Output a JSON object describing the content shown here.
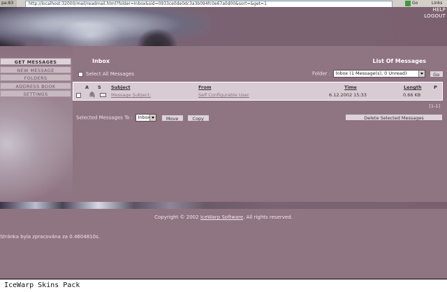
{
  "browser": {
    "tab_prefix": "pa:83",
    "url": "http://localhost:32000/mail/readmail.html?folder=Inbox&sid=0933ce0de0dc3a3b094fc0e67a0d00&sort=&get=1",
    "go_label": "Go",
    "links_label": "Links"
  },
  "header": {
    "help": "HELP",
    "logout": "LOGOUT"
  },
  "nav": {
    "items": [
      {
        "label": "GET MESSAGES"
      },
      {
        "label": "NEW MESSAGE"
      },
      {
        "label": "FOLDERS"
      },
      {
        "label": "ADDRESS BOOK"
      },
      {
        "label": "SETTINGS"
      }
    ]
  },
  "main": {
    "title": "Inbox",
    "list_title": "List Of Messages",
    "select_all": "Select All Messages",
    "folder_label": "Folder :",
    "folder_value": "Inbox (1 Message(s), 0 Unread)",
    "go_button": "Go",
    "columns": {
      "a": "A",
      "s": "S",
      "subject": "Subject",
      "from": "From",
      "time": "Time",
      "length": "Length",
      "p": "P"
    },
    "messages": [
      {
        "subject": "Message Subject:",
        "from": "Self Configurable User",
        "time": "6.12.2002 15:33",
        "length": "0.66 KB"
      }
    ],
    "pager": "[1-1]",
    "selected_to": "Selected Messages To :",
    "target_folder": "Inbox",
    "move": "Move",
    "copy": "Copy",
    "delete_selected": "Delete Selected Messages"
  },
  "footer": {
    "copyright_pre": "Copyright © 2002",
    "company": "IceWarp Software",
    "copyright_post": ". All rights reserved.",
    "processed": "Stránka byla zpracována za 0.4604810s."
  },
  "status": {
    "text": "IceWarp Skins Pack"
  }
}
